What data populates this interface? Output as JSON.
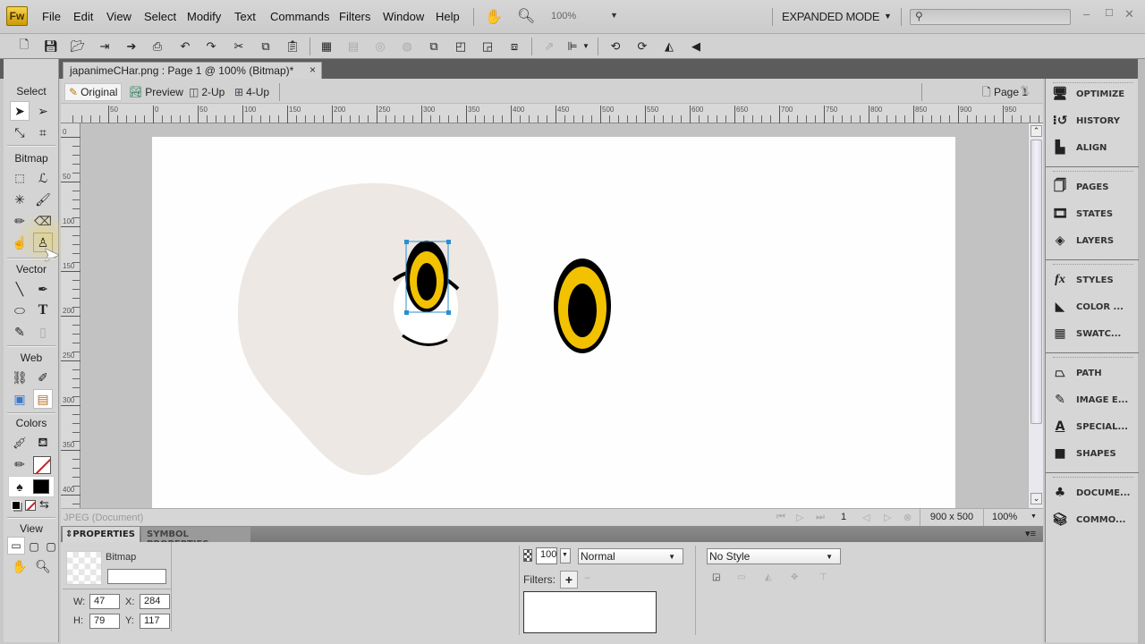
{
  "app": {
    "logo": "Fw"
  },
  "menubar": {
    "items": [
      "File",
      "Edit",
      "View",
      "Select",
      "Modify",
      "Text",
      "Commands",
      "Filters",
      "Window",
      "Help"
    ],
    "zoom": "100%",
    "mode": "EXPANDED MODE",
    "search_placeholder": ""
  },
  "toolbar": {
    "icons": [
      "new-icon",
      "save-icon",
      "open-icon",
      "import-icon",
      "export-icon",
      "print-icon",
      "undo-icon",
      "redo-icon",
      "cut-icon",
      "copy-icon",
      "paste-icon",
      "group-icon",
      "ungroup-icon",
      "join-icon",
      "split-icon",
      "bring-to-front-icon",
      "bring-forward-icon",
      "send-backward-icon",
      "send-to-back-icon",
      "align-disabled-icon",
      "align-icon",
      "rotate-ccw-icon",
      "rotate-cw-icon",
      "flip-horizontal-icon",
      "flip-vertical-icon"
    ]
  },
  "document": {
    "tab_title": "japanimeCHar.png : Page 1 @ 100% (Bitmap)*",
    "close": "×",
    "views": [
      "Original",
      "Preview",
      "2-Up",
      "4-Up"
    ],
    "active_view": "Original",
    "page": "Page 1",
    "hruler_labels": [
      "50",
      "0",
      "50",
      "100",
      "150",
      "200",
      "250",
      "300",
      "350",
      "400",
      "450",
      "500",
      "550",
      "600",
      "650",
      "700",
      "750",
      "800",
      "850",
      "900",
      "950"
    ],
    "vruler_labels": [
      "0",
      "50",
      "100",
      "150",
      "200",
      "250",
      "300",
      "350",
      "400"
    ]
  },
  "tools": {
    "sections": [
      "Select",
      "Bitmap",
      "Vector",
      "Web",
      "Colors",
      "View"
    ],
    "tooltip": "Rubber Stamp"
  },
  "status": {
    "doc_type": "JPEG (Document)",
    "frame": "1",
    "size": "900 x 500",
    "zoom": "100%"
  },
  "properties": {
    "tabs": [
      "PROPERTIES",
      "SYMBOL PROPERTIES"
    ],
    "object_type": "Bitmap",
    "name_value": "",
    "w_label": "W:",
    "w": "47",
    "h_label": "H:",
    "h": "79",
    "x_label": "X:",
    "x": "284",
    "y_label": "Y:",
    "y": "117",
    "opacity": "100",
    "blend": "Normal",
    "filters_label": "Filters:",
    "style": "No Style"
  },
  "panels": {
    "groups": [
      [
        "OPTIMIZE",
        "HISTORY",
        "ALIGN"
      ],
      [
        "PAGES",
        "STATES",
        "LAYERS"
      ],
      [
        "STYLES",
        "COLOR ...",
        "SWATC..."
      ],
      [
        "PATH",
        "IMAGE E...",
        "SPECIAL...",
        "SHAPES"
      ],
      [
        "DOCUME...",
        "COMMO..."
      ]
    ]
  },
  "colors": {
    "face": "#ede8e3",
    "iris": "#f2c200",
    "pupil": "#000000",
    "selection": "#2a8fd0",
    "stroke": "#000000",
    "fill": "#000000"
  }
}
